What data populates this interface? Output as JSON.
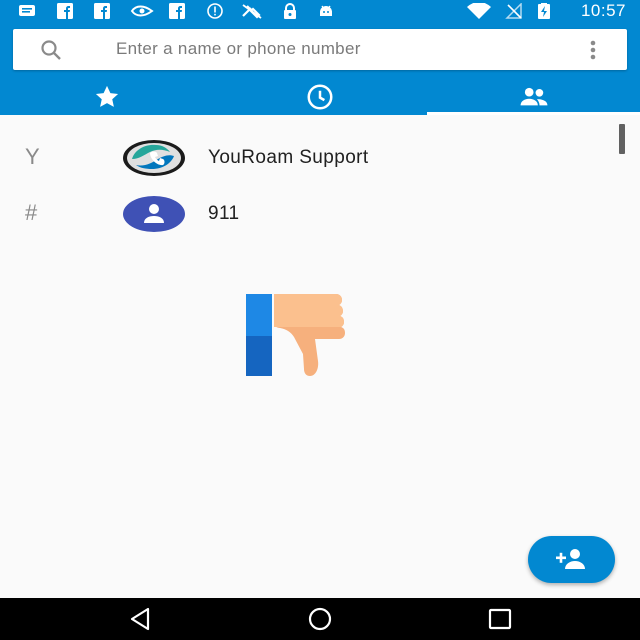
{
  "status_bar": {
    "time": "10:57",
    "left_icons": [
      "message-icon",
      "facebook-icon",
      "facebook-icon",
      "nvidia-icon",
      "facebook-icon",
      "alert-icon",
      "no-sim-tool-icon",
      "lock-icon",
      "android-icon"
    ],
    "right_icons": [
      "wifi-icon",
      "no-signal-icon",
      "battery-charging-icon"
    ]
  },
  "search": {
    "placeholder": "Enter a name or phone number"
  },
  "tabs": [
    {
      "icon": "star-icon",
      "label": "Favorites",
      "selected": false
    },
    {
      "icon": "clock-icon",
      "label": "Recents",
      "selected": false
    },
    {
      "icon": "people-icon",
      "label": "Contacts",
      "selected": true
    }
  ],
  "contacts": [
    {
      "section": "Y",
      "name": "YouRoam Support",
      "avatar": "youroam-logo-icon"
    },
    {
      "section": "#",
      "name": "911",
      "avatar": "person-icon"
    }
  ],
  "overlay": {
    "icon": "thumbs-down-icon"
  },
  "fab": {
    "icon": "add-contact-icon"
  },
  "nav_bar": [
    "back-icon",
    "home-icon",
    "recents-icon"
  ],
  "colors": {
    "primary": "#0288d1",
    "background": "#fafafa",
    "avatar_default": "#3f51b5",
    "text_primary": "#212121",
    "text_secondary": "#8a8a8a"
  }
}
